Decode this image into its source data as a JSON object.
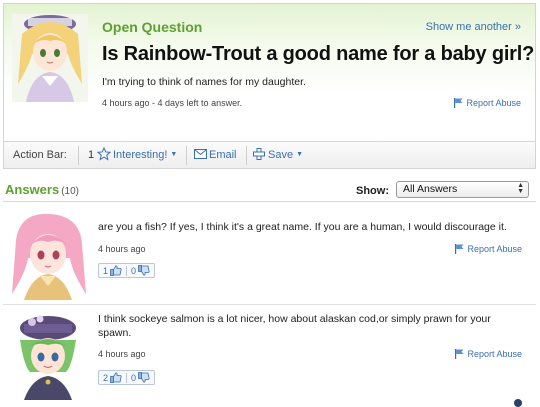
{
  "question": {
    "label": "Open Question",
    "show_another": "Show me another »",
    "title": "Is Rainbow-Trout a good name for a baby girl?",
    "body": "I'm trying to think of names for my daughter.",
    "meta": "4 hours ago - 4 days left to answer.",
    "report": "Report Abuse"
  },
  "action_bar": {
    "label": "Action Bar:",
    "interesting_count": "1",
    "interesting": "Interesting!",
    "email": "Email",
    "save": "Save"
  },
  "answers": {
    "title": "Answers",
    "count": "(10)",
    "show_label": "Show:",
    "filter_value": "All Answers",
    "items": [
      {
        "text": "are you a fish? If yes, I think it's a great name. If you are a human, I would discourage it.",
        "time": "4 hours ago",
        "report": "Report Abuse",
        "thumbs_up": "1",
        "thumbs_down": "0"
      },
      {
        "text": "I think sockeye salmon is a lot nicer, how about alaskan cod,or simply prawn for your spawn.",
        "time": "4 hours ago",
        "report": "Report Abuse",
        "thumbs_up": "2",
        "thumbs_down": "0"
      }
    ]
  },
  "colors": {
    "accent_green": "#5da130",
    "link_blue": "#3a6fb0"
  }
}
